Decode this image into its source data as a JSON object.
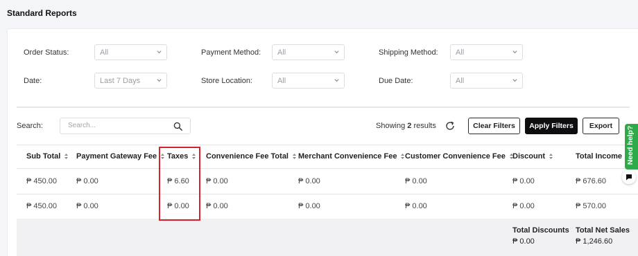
{
  "page": {
    "title": "Standard Reports"
  },
  "filters": {
    "order_status": {
      "label": "Order Status:",
      "value": "All"
    },
    "payment_method": {
      "label": "Payment Method:",
      "value": "All"
    },
    "shipping_method": {
      "label": "Shipping Method:",
      "value": "All"
    },
    "date": {
      "label": "Date:",
      "value": "Last 7 Days"
    },
    "store_location": {
      "label": "Store Location:",
      "value": "All"
    },
    "due_date": {
      "label": "Due Date:",
      "value": "All"
    }
  },
  "toolbar": {
    "search_label": "Search:",
    "search_placeholder": "Search...",
    "showing_prefix": "Showing",
    "showing_count": "2",
    "showing_suffix": "results",
    "clear_filters": "Clear Filters",
    "apply_filters": "Apply Filters",
    "export": "Export"
  },
  "table": {
    "columns": [
      "Sub Total",
      "Payment Gateway Fee",
      "Taxes",
      "Convenience Fee Total",
      "Merchant Convenience Fee",
      "Customer Convenience Fee",
      "Discount",
      "Total Income"
    ],
    "rows": [
      [
        "₱ 450.00",
        "₱ 0.00",
        "₱ 6.60",
        "₱ 0.00",
        "₱ 0.00",
        "₱ 0.00",
        "₱ 0.00",
        "₱ 676.60"
      ],
      [
        "₱ 450.00",
        "₱ 0.00",
        "₱ 0.00",
        "₱ 0.00",
        "₱ 0.00",
        "₱ 0.00",
        "₱ 0.00",
        "₱ 570.00"
      ]
    ],
    "footer": {
      "total_discounts_label": "Total Discounts",
      "total_discounts_value": "₱ 0.00",
      "total_net_sales_label": "Total Net Sales",
      "total_net_sales_value": "₱ 1,246.60"
    }
  },
  "help": {
    "label": "Need help?"
  },
  "colors": {
    "accent_dark": "#0e0e10",
    "highlight": "#d2232a",
    "help_green": "#2faa4a"
  },
  "icons": {
    "select": "chevron-down-icon",
    "search": "search-icon",
    "refresh": "refresh-icon",
    "sort": "sort-icon",
    "chat": "chat-icon"
  }
}
